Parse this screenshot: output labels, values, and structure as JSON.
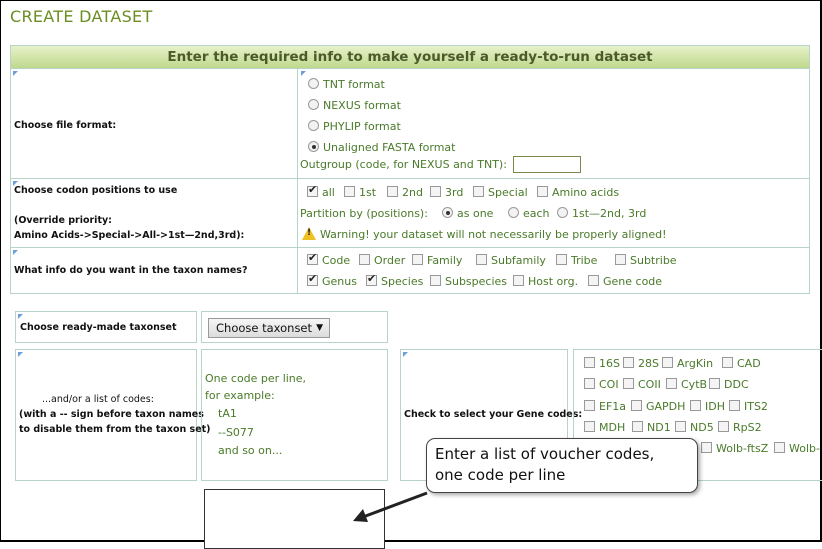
{
  "title": "CREATE DATASET",
  "header": "Enter the required info to make yourself a ready-to-run dataset",
  "format": {
    "label": "Choose file format:",
    "options": [
      "TNT format",
      "NEXUS format",
      "PHYLIP format",
      "Unaligned FASTA format"
    ],
    "selected_index": 3,
    "outgroup_label": "Outgroup (code, for NEXUS and TNT):",
    "outgroup_value": ""
  },
  "codon": {
    "label": "Choose codon positions to use",
    "override_label": "(Override priority:",
    "override_chain": "Amino Acids->Special->All->1st—2nd,3rd):",
    "options": [
      "all",
      "1st",
      "2nd",
      "3rd",
      "Special",
      "Amino acids"
    ],
    "partition_label": "Partition by (positions):",
    "partition_options": [
      "as one",
      "each",
      "1st—2nd, 3rd"
    ],
    "warning": "Warning! your dataset will not necessarily be properly aligned!"
  },
  "taxon_names": {
    "label": "What info do you want in the taxon names?",
    "row1": [
      "Code",
      "Order",
      "Family",
      "Subfamily",
      "Tribe",
      "Subtribe"
    ],
    "row2": [
      "Genus",
      "Species",
      "Subspecies",
      "Host org.",
      "Gene code"
    ]
  },
  "taxonset": {
    "label": "Choose ready-made taxonset",
    "select_value": "Choose taxonset"
  },
  "codes": {
    "label_lines": [
      "...and/or a list of codes:",
      "(with a -- sign before taxon names",
      "to disable them from the taxon set)"
    ],
    "hint_lines": [
      "One code per line,",
      "for example:",
      "tA1",
      "--S077",
      "and so on..."
    ]
  },
  "genes": {
    "label": "Check to select your Gene codes:",
    "row1": [
      "16S",
      "28S",
      "ArgKin",
      "CAD"
    ],
    "row2": [
      "COI",
      "COII",
      "CytB",
      "DDC"
    ],
    "row3": [
      "EF1a",
      "GAPDH",
      "IDH",
      "ITS2"
    ],
    "row4": [
      "MDH",
      "ND1",
      "ND5",
      "RpS2"
    ],
    "row5": [
      "Wolb-ftsZ",
      "Wolb-"
    ]
  },
  "callout": {
    "line1": "Enter a list of voucher codes,",
    "line2": "one code per line"
  },
  "colors": {
    "accent": "#6b8e23",
    "text_green": "#4a7a2a",
    "border": "#b8d4c8"
  }
}
